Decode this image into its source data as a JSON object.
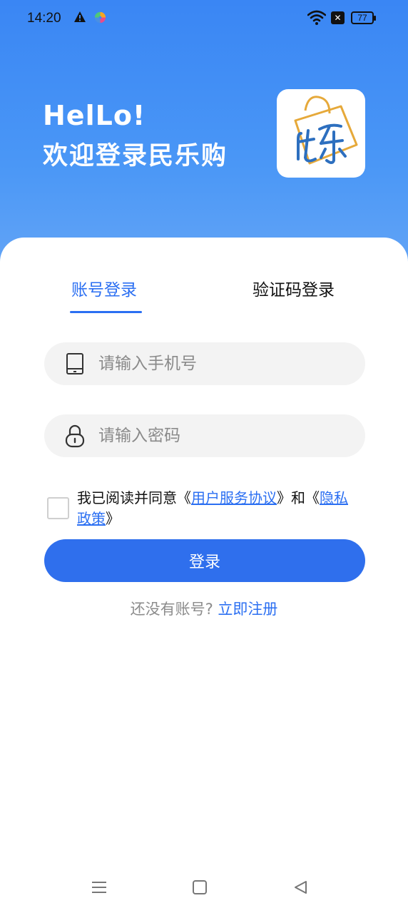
{
  "status_bar": {
    "time": "14:20",
    "battery": "77",
    "icons": [
      "warning-icon",
      "app-pin-icon",
      "wifi-icon",
      "no-sim-icon",
      "battery-icon"
    ]
  },
  "hero": {
    "greeting_line1": "HelLo!",
    "greeting_line2": "欢迎登录民乐购",
    "logo_text": "民乐",
    "gradient_top": "#3a86f4",
    "gradient_bottom": "#6aa8f6"
  },
  "tabs": {
    "account_login": "账号登录",
    "code_login": "验证码登录",
    "active": "account_login",
    "accent": "#2b6ff2"
  },
  "form": {
    "phone_placeholder": "请输入手机号",
    "phone_value": "",
    "password_placeholder": "请输入密码",
    "password_value": "",
    "agree_checked": false,
    "agree_prefix": "我已阅读并同意《",
    "user_agreement": "用户服务协议",
    "agree_middle": "》和《",
    "privacy_policy": "隐私政策",
    "agree_suffix": "》",
    "login_button": "登录"
  },
  "register": {
    "prompt": "还没有账号?",
    "link": "立即注册"
  },
  "nav_bar": {
    "icons": [
      "menu-icon",
      "home-icon",
      "back-icon"
    ]
  }
}
